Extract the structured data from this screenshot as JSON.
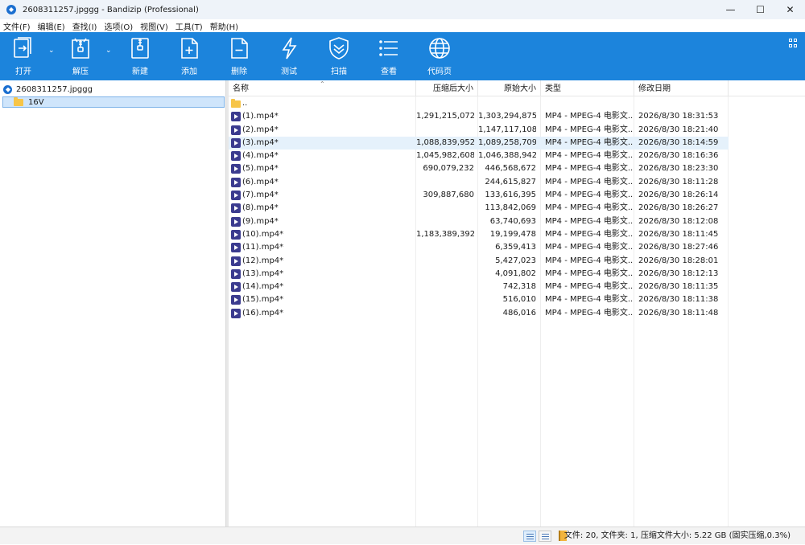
{
  "window": {
    "title": "2608311257.jpggg - Bandizip (Professional)"
  },
  "controls": {
    "minimize": "—",
    "maximize": "☐",
    "close": "✕"
  },
  "menu": [
    "文件(F)",
    "编辑(E)",
    "查找(I)",
    "选项(O)",
    "视图(V)",
    "工具(T)",
    "帮助(H)"
  ],
  "toolbar": {
    "open": "打开",
    "extract": "解压",
    "new": "新建",
    "add": "添加",
    "delete": "删除",
    "test": "测试",
    "scan": "扫描",
    "view": "查看",
    "codepage": "代码页"
  },
  "tree": {
    "root": "2608311257.jpggg",
    "child": "16V"
  },
  "columns": {
    "name": "名称",
    "compressed": "压缩后大小",
    "original": "原始大小",
    "type": "类型",
    "modified": "修改日期"
  },
  "parent_entry": "..",
  "files": [
    {
      "name": "(1).mp4*",
      "compressed": "1,291,215,072",
      "original": "1,303,294,875",
      "type": "MP4 - MPEG-4 电影文...",
      "modified": "2026/8/30 18:31:53"
    },
    {
      "name": "(2).mp4*",
      "compressed": "",
      "original": "1,147,117,108",
      "type": "MP4 - MPEG-4 电影文...",
      "modified": "2026/8/30 18:21:40"
    },
    {
      "name": "(3).mp4*",
      "compressed": "1,088,839,952",
      "original": "1,089,258,709",
      "type": "MP4 - MPEG-4 电影文...",
      "modified": "2026/8/30 18:14:59"
    },
    {
      "name": "(4).mp4*",
      "compressed": "1,045,982,608",
      "original": "1,046,388,942",
      "type": "MP4 - MPEG-4 电影文...",
      "modified": "2026/8/30 18:16:36"
    },
    {
      "name": "(5).mp4*",
      "compressed": "690,079,232",
      "original": "446,568,672",
      "type": "MP4 - MPEG-4 电影文...",
      "modified": "2026/8/30 18:23:30"
    },
    {
      "name": "(6).mp4*",
      "compressed": "",
      "original": "244,615,827",
      "type": "MP4 - MPEG-4 电影文...",
      "modified": "2026/8/30 18:11:28"
    },
    {
      "name": "(7).mp4*",
      "compressed": "309,887,680",
      "original": "133,616,395",
      "type": "MP4 - MPEG-4 电影文...",
      "modified": "2026/8/30 18:26:14"
    },
    {
      "name": "(8).mp4*",
      "compressed": "",
      "original": "113,842,069",
      "type": "MP4 - MPEG-4 电影文...",
      "modified": "2026/8/30 18:26:27"
    },
    {
      "name": "(9).mp4*",
      "compressed": "",
      "original": "63,740,693",
      "type": "MP4 - MPEG-4 电影文...",
      "modified": "2026/8/30 18:12:08"
    },
    {
      "name": "(10).mp4*",
      "compressed": "1,183,389,392",
      "original": "19,199,478",
      "type": "MP4 - MPEG-4 电影文...",
      "modified": "2026/8/30 18:11:45"
    },
    {
      "name": "(11).mp4*",
      "compressed": "",
      "original": "6,359,413",
      "type": "MP4 - MPEG-4 电影文...",
      "modified": "2026/8/30 18:27:46"
    },
    {
      "name": "(12).mp4*",
      "compressed": "",
      "original": "5,427,023",
      "type": "MP4 - MPEG-4 电影文...",
      "modified": "2026/8/30 18:28:01"
    },
    {
      "name": "(13).mp4*",
      "compressed": "",
      "original": "4,091,802",
      "type": "MP4 - MPEG-4 电影文...",
      "modified": "2026/8/30 18:12:13"
    },
    {
      "name": "(14).mp4*",
      "compressed": "",
      "original": "742,318",
      "type": "MP4 - MPEG-4 电影文...",
      "modified": "2026/8/30 18:11:35"
    },
    {
      "name": "(15).mp4*",
      "compressed": "",
      "original": "516,010",
      "type": "MP4 - MPEG-4 电影文...",
      "modified": "2026/8/30 18:11:38"
    },
    {
      "name": "(16).mp4*",
      "compressed": "",
      "original": "486,016",
      "type": "MP4 - MPEG-4 电影文...",
      "modified": "2026/8/30 18:11:48"
    }
  ],
  "selected_row": 2,
  "status": {
    "text": "文件: 20, 文件夹: 1, 压缩文件大小: 5.22 GB (固实压缩,0.3%)"
  },
  "colors": {
    "toolbar": "#1c84dc",
    "selection": "#e5f1fb",
    "tree_selection": "#cfe5fb"
  },
  "icons": {
    "toolbar": [
      "open-icon",
      "extract-icon",
      "new-archive-icon",
      "add-file-icon",
      "delete-file-icon",
      "test-lightning-icon",
      "scan-shield-icon",
      "view-list-icon",
      "codepage-globe-icon"
    ],
    "file": "video-file-icon",
    "folder": "folder-icon"
  }
}
